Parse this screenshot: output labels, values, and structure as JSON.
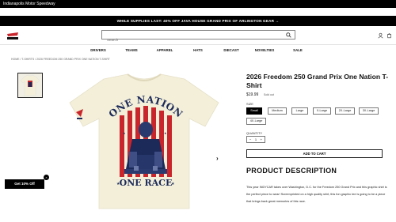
{
  "topbar": {
    "label": "Indianapolis Motor Speedway"
  },
  "promo": {
    "text": "WHILE SUPPLIES LAST: 40% OFF JAVA HOUSE GRAND PRIX OF ARLINGTON GEAR  →"
  },
  "header": {
    "search_placeholder": "Search"
  },
  "nav": {
    "items": [
      "DRIVERS",
      "TEAMS",
      "APPAREL",
      "HATS",
      "DIECAST",
      "NOVELTIES",
      "SALE"
    ]
  },
  "breadcrumb": "HOME  /  T-SHIRTS  /  2026 FREEDOM 250 GRAND PRIX ONE NATION T-SHIRT",
  "product": {
    "title": "2026 Freedom 250 Grand Prix One Nation T-Shirt",
    "price": "$19.99",
    "sold_out": "Sold out",
    "size_label": "SIZE",
    "sizes": [
      "Small",
      "Medium",
      "Large",
      "X-Large",
      "2X-Large",
      "3X-Large",
      "4X-Large"
    ],
    "selected_size": "Small",
    "quantity_label": "QUANTITY",
    "quantity": "1",
    "add_to_cart": "ADD TO CART",
    "description_title": "PRODUCT DESCRIPTION",
    "description": "This year INDYCAR takes over Washington, D.C. for the Freedom 250 Grand Prix and this graphic shirt is the perfect piece to wear! Screenprinted on a high quality shirt, this fun graphic tee is going to be a piece that brings back great memories of this race.",
    "shirt_text_top": "ONE NATION",
    "shirt_text_bottom": "ONE RACE"
  },
  "popup": {
    "label": "Get 10% Off",
    "close": "×"
  },
  "colors": {
    "shirt": "#f3efd9",
    "red": "#c8262c",
    "navy": "#1c2a5a"
  }
}
